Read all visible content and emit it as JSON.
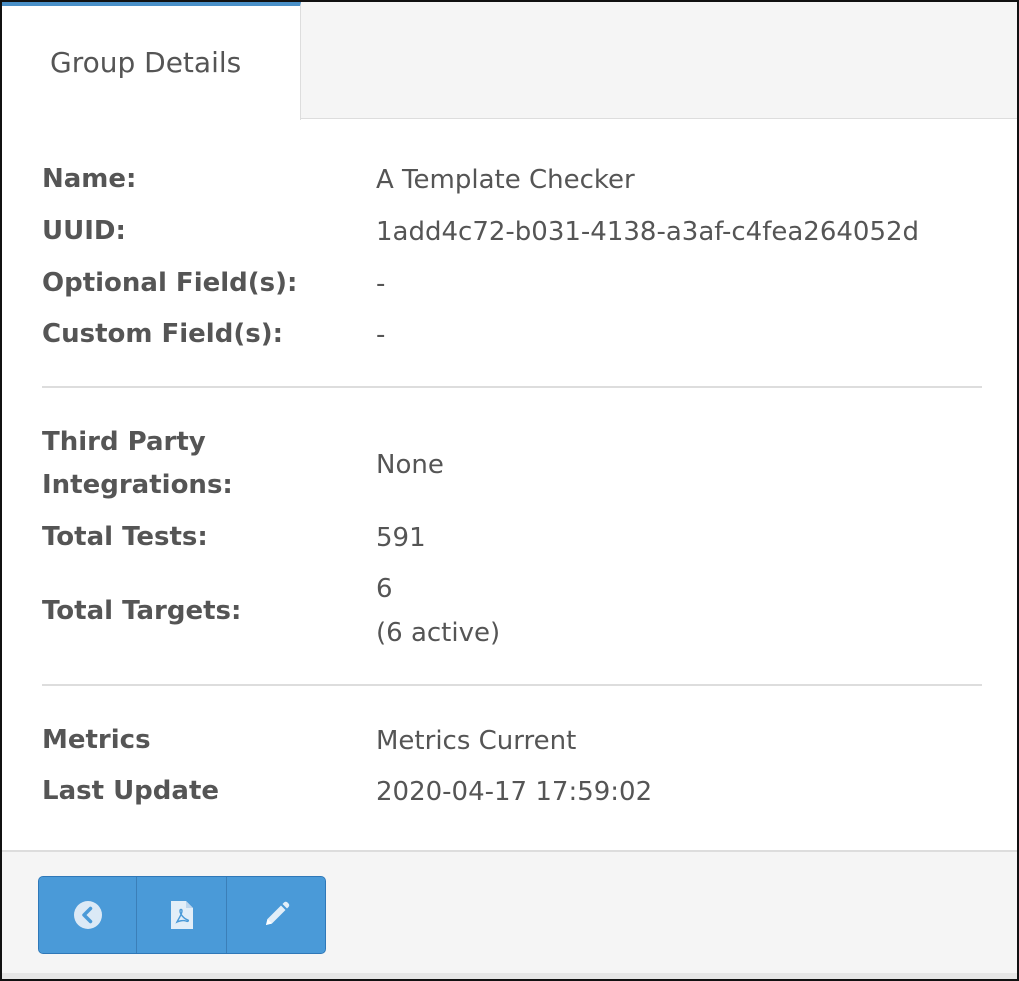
{
  "tabs": [
    {
      "label": "Group Details",
      "active": true
    }
  ],
  "details": {
    "name": {
      "label": "Name:",
      "value": "A Template Checker"
    },
    "uuid": {
      "label": "UUID:",
      "value": "1add4c72-b031-4138-a3af-c4fea264052d"
    },
    "optional_fields": {
      "label": "Optional Field(s):",
      "value": "-"
    },
    "custom_fields": {
      "label": "Custom Field(s):",
      "value": "-"
    },
    "third_party": {
      "label_line1": "Third Party",
      "label_line2": "Integrations:",
      "value": "None"
    },
    "total_tests": {
      "label": "Total Tests:",
      "value": "591"
    },
    "total_targets": {
      "label": "Total Targets:",
      "value": "6",
      "sub_value": "(6 active)"
    },
    "metrics": {
      "label": "Metrics",
      "value": "Metrics Current"
    },
    "last_update": {
      "label": "Last Update",
      "value": "2020-04-17 17:59:02"
    }
  },
  "footer": {
    "buttons": [
      {
        "icon": "chevron-left-circle-icon"
      },
      {
        "icon": "pdf-file-icon"
      },
      {
        "icon": "pencil-icon"
      }
    ]
  },
  "colors": {
    "accent": "#4a90c8",
    "button": "#4a9ad8",
    "text": "#555555"
  }
}
